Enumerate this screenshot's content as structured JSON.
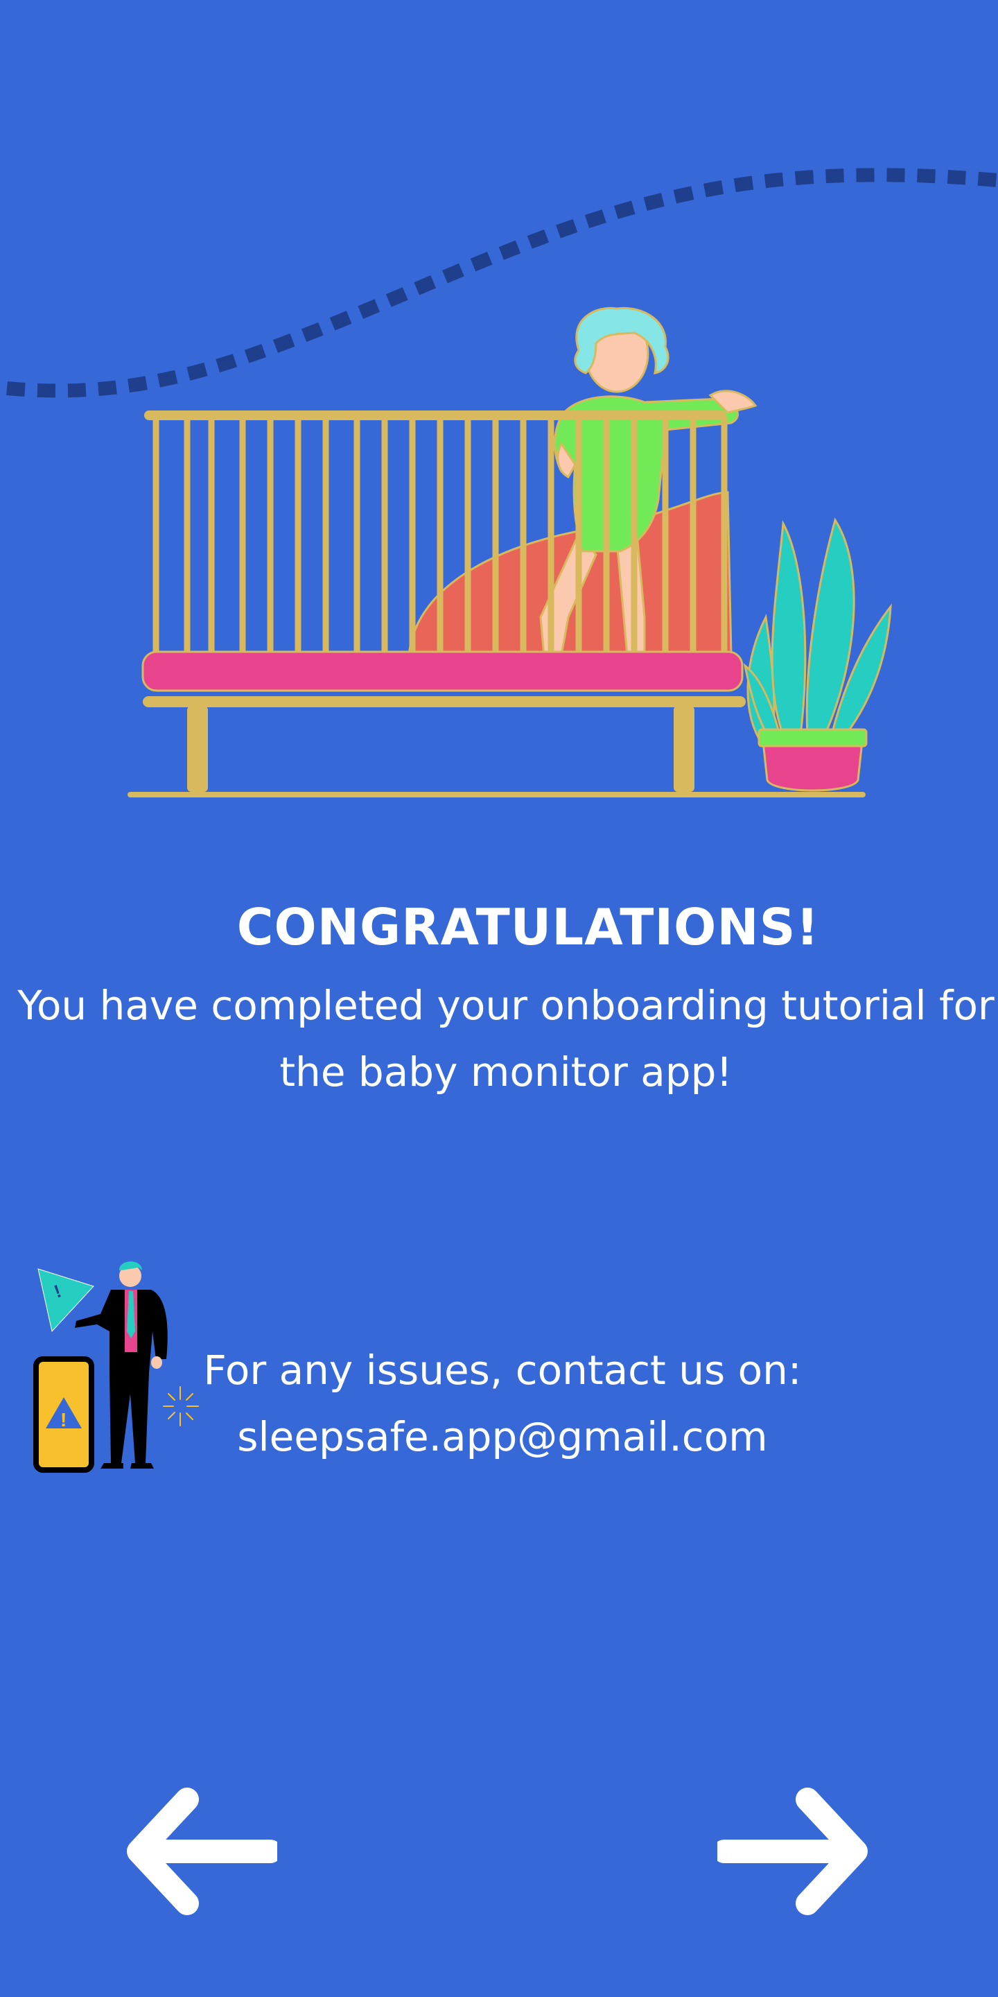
{
  "screen": {
    "title": "CONGRATULATIONS!",
    "message": "You have completed your onboarding tutorial for the baby monitor app!",
    "contact_line_1": "For any issues, contact us on:",
    "contact_line_2": "sleepsafe.app@gmail.com"
  },
  "icons": {
    "back": "arrow-left-icon",
    "next": "arrow-right-icon",
    "hero": "baby-in-crib-illustration",
    "support": "support-person-illustration"
  },
  "colors": {
    "background": "#3669d7",
    "text": "#ffffff",
    "crib": "#d9b95d",
    "mattress": "#e8448e",
    "pillow": "#e86557",
    "baby_suit": "#72ea57",
    "baby_hair": "#86e6e6",
    "plant": "#25cec0",
    "wave": "#1f3f8c"
  }
}
